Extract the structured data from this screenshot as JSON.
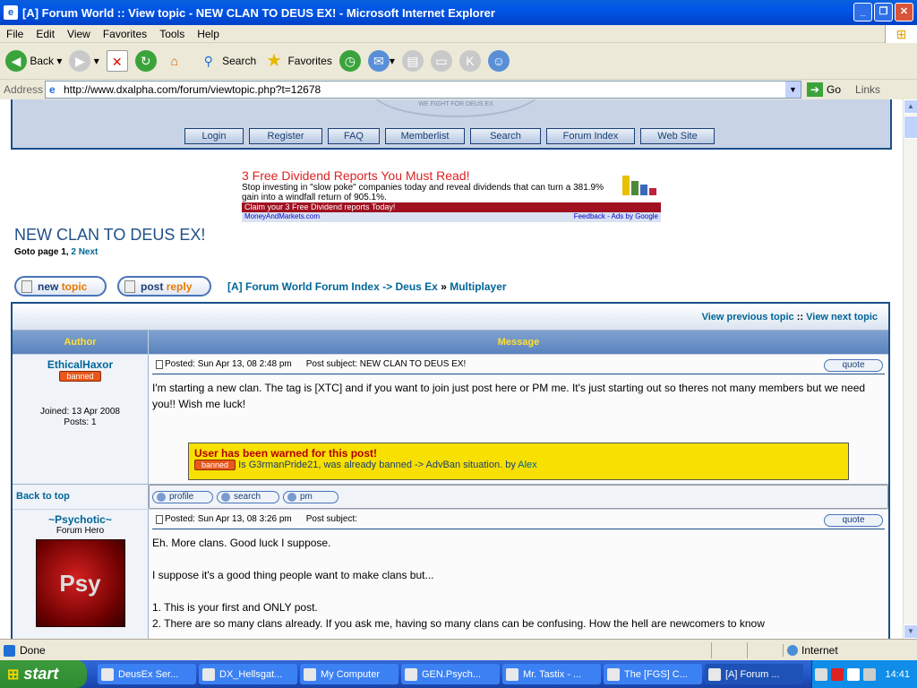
{
  "window": {
    "title": "[A] Forum World :: View topic - NEW CLAN TO DEUS EX! - Microsoft Internet Explorer"
  },
  "menu": {
    "items": [
      "File",
      "Edit",
      "View",
      "Favorites",
      "Tools",
      "Help"
    ]
  },
  "toolbar": {
    "back": "Back",
    "search": "Search",
    "favorites": "Favorites"
  },
  "address": {
    "label": "Address",
    "url": "http://www.dxalpha.com/forum/viewtopic.php?t=12678",
    "go": "Go",
    "links": "Links"
  },
  "site": {
    "logo_text": "WE FIGHT FOR DEUS EX",
    "nav": [
      "Login",
      "Register",
      "FAQ",
      "Memberlist",
      "Search",
      "Forum Index",
      "Web Site"
    ]
  },
  "ad": {
    "headline": "3 Free Dividend Reports You Must Read!",
    "body": "Stop investing in \"slow poke\" companies today and reveal dividends that can turn a 381.9% gain into a windfall return of 905.1%.",
    "cta": "Claim your 3 Free Dividend reports Today!",
    "source": "MoneyAndMarkets.com",
    "feedback": "Feedback - Ads by Google"
  },
  "topic": {
    "title": "NEW CLAN TO DEUS EX!",
    "goto_label": "Goto page",
    "page1": "1",
    "page2": "2",
    "next": "Next",
    "new_topic": {
      "a": "new",
      "b": "topic"
    },
    "post_reply": {
      "a": "post",
      "b": "reply"
    },
    "breadcrumb": {
      "index": "[A] Forum World Forum Index",
      "sep1": "->",
      "cat": "Deus Ex",
      "sep2": "»",
      "forum": "Multiplayer"
    },
    "prev_topic": "View previous topic",
    "next_topic": "View next topic",
    "col_author": "Author",
    "col_message": "Message"
  },
  "posts": [
    {
      "author": "EthicalHaxor",
      "rank": "banned",
      "joined": "Joined: 13 Apr 2008",
      "posts": "Posts: 1",
      "posted": "Posted: Sun Apr 13, 08 2:48 pm",
      "subject": "Post subject: NEW CLAN TO DEUS EX!",
      "quote": "quote",
      "text": "I'm starting a new clan. The tag is [XTC] and if you want to join just post here or PM me. It's just starting out so theres not many members but we need you!! Wish me luck!",
      "warning_title": "User has been warned for this post!",
      "warning_badge": "banned",
      "warning_text": "Is G3rmanPride21, was already banned -> AdvBan situation. by",
      "warning_by": "Alex"
    },
    {
      "author": "~Psychotic~",
      "title": "Forum Hero",
      "avatar_text": "Psy",
      "posted": "Posted: Sun Apr 13, 08 3:26 pm",
      "subject": "Post subject:",
      "quote": "quote",
      "lines": [
        "Eh. More clans. Good luck I suppose.",
        "I suppose it's a good thing people want to make clans but...",
        "1. This is your first and ONLY post.",
        "2. There are so many clans already. If you ask me, having so many clans can be confusing. How the hell are newcomers to know"
      ]
    }
  ],
  "util": {
    "back_to_top": "Back to top",
    "profile": "profile",
    "search": "search",
    "pm": "pm"
  },
  "status": {
    "text": "Done",
    "zone": "Internet"
  },
  "taskbar": {
    "start": "start",
    "tasks": [
      "DeusEx Ser...",
      "DX_Hellsgat...",
      "My Computer",
      "GEN.Psych...",
      "Mr. Tastix - ...",
      "The [FGS] C...",
      "[A] Forum ..."
    ],
    "clock": "14:41"
  }
}
